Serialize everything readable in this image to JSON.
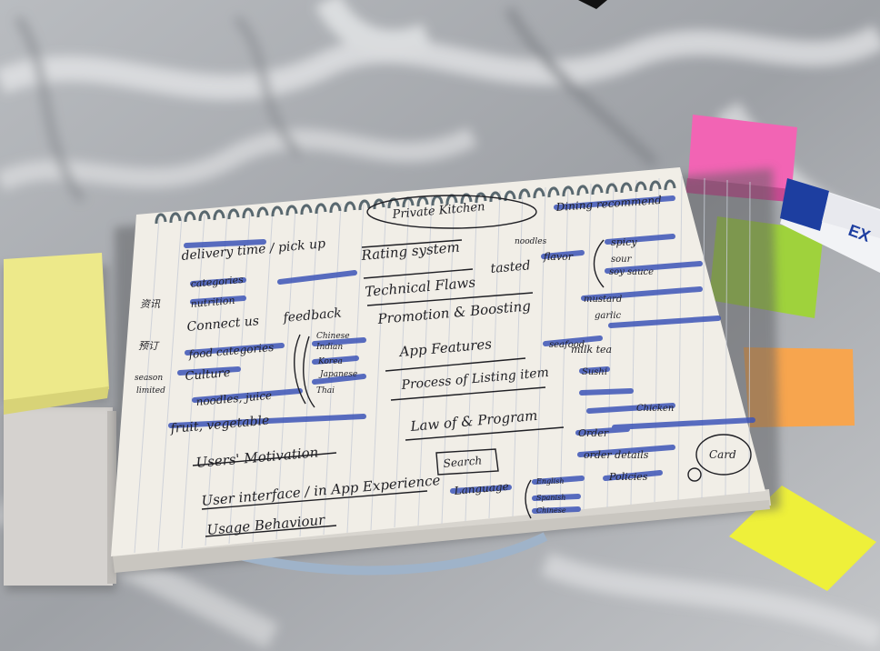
{
  "notebook": {
    "title": "Private Kitchen",
    "left_column": [
      "delivery time / pick up",
      "categories",
      "nutrition",
      "Connect us",
      "feedback",
      "food categories",
      "Culture",
      "noodles, juice",
      "fruit, vegetable",
      "Users' Motivation",
      "User interface / in App Experience",
      "Usage Behaviour"
    ],
    "left_margin": [
      "资讯",
      "预订",
      "season",
      "limited"
    ],
    "middle_column": [
      "Rating system",
      "Technical Flaws",
      "Promotion & Boosting",
      "App Features",
      "Process of Listing item",
      "Law of & Program",
      "Search",
      "Language"
    ],
    "languages": [
      "English",
      "Spanish",
      "Chinese"
    ],
    "right_column": [
      "Dining recommend",
      "tasted",
      "noodles",
      "flavor",
      "spicy",
      "sour",
      "soy sauce",
      "mustard",
      "garlic",
      "seafood",
      "milk tea",
      "Sushi",
      "Chicken",
      "Order",
      "order details",
      "Policies",
      "Card"
    ],
    "cuisines": [
      "Chinese",
      "Indian",
      "Korea",
      "Japanese",
      "Thai"
    ]
  },
  "colors": {
    "highlighter": "#3d55b8",
    "ink": "#1f1f24",
    "sticky_pink": "#f264b4",
    "sticky_green": "#9fd23c",
    "sticky_orange": "#f7a54e",
    "sticky_yellow": "#eef03a",
    "sticky_pale_yellow": "#ede98a",
    "marker_blue": "#1d3ea0"
  }
}
